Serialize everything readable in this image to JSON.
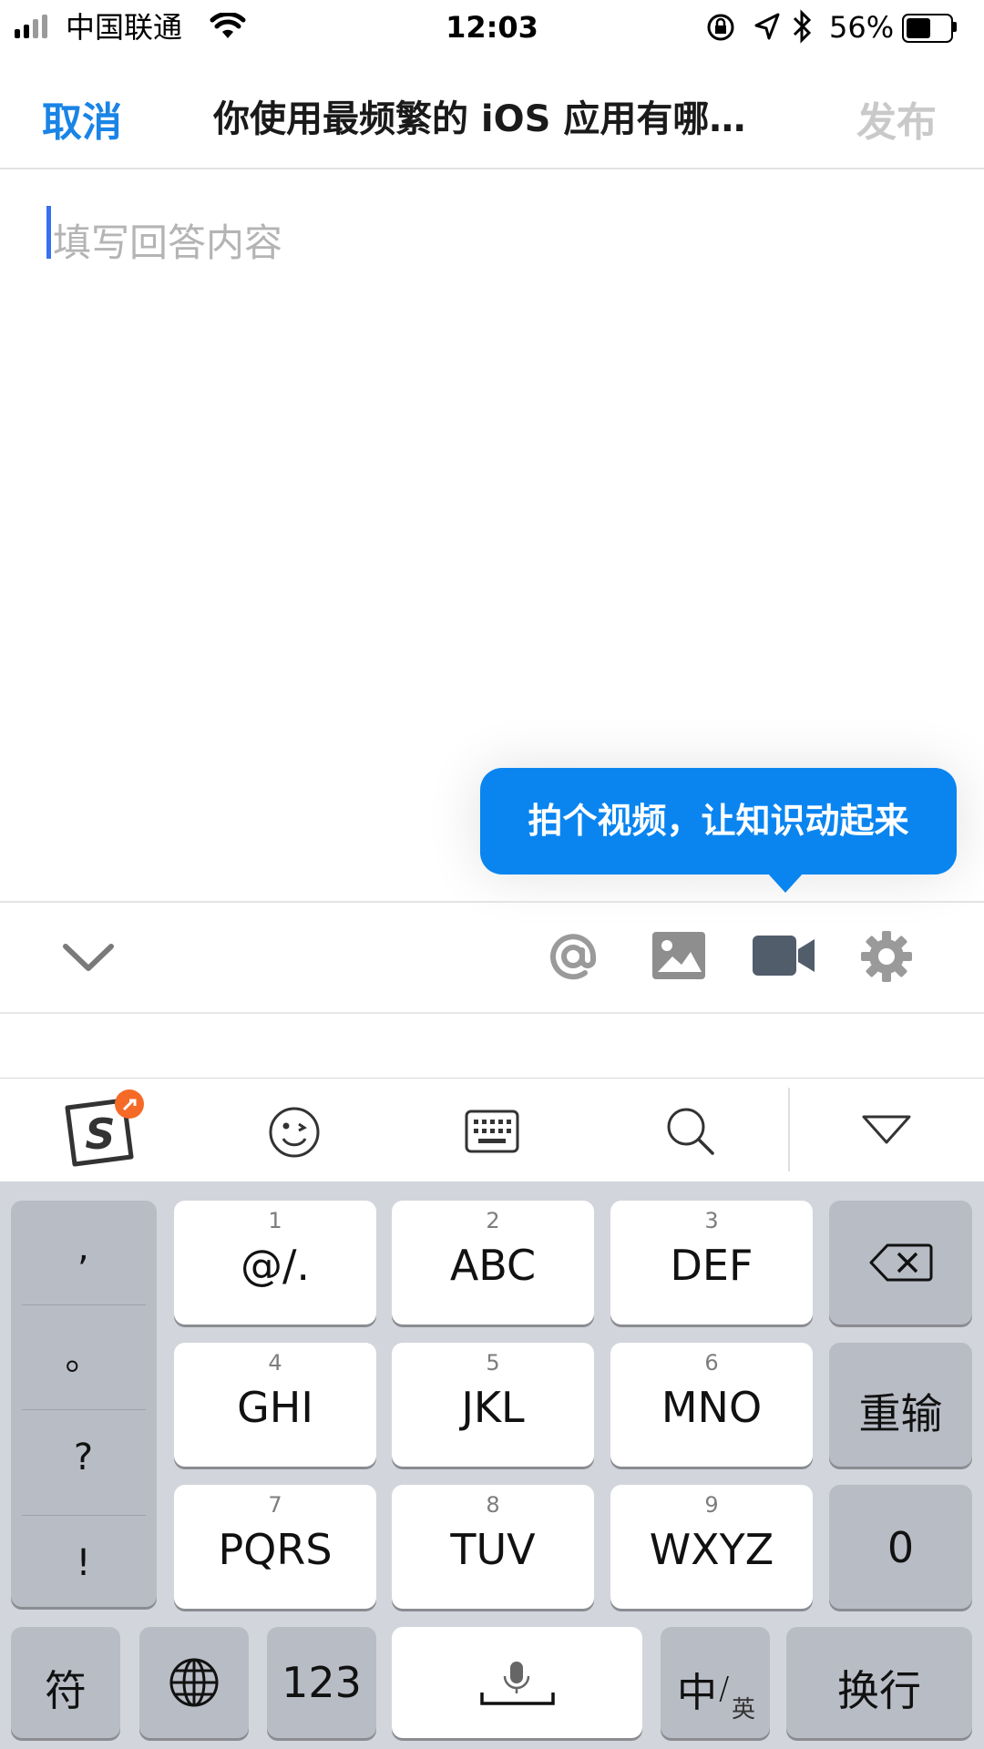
{
  "status_bar": {
    "carrier": "中国联通",
    "time": "12:03",
    "battery_percent": "56%",
    "battery_level": 0.56
  },
  "nav": {
    "cancel_label": "取消",
    "title": "你使用最频繁的 iOS 应用有哪…",
    "publish_label": "发布"
  },
  "editor": {
    "placeholder": "填写回答内容"
  },
  "tooltip": {
    "text": "拍个视频，让知识动起来"
  },
  "toolbar": {
    "icons": [
      "chevron-down-icon",
      "at-icon",
      "image-icon",
      "video-camera-icon",
      "gear-icon"
    ]
  },
  "keyboard": {
    "top_bar_icons": [
      "sogou-logo-icon",
      "emoji-icon",
      "keyboard-icon",
      "search-icon",
      "collapse-triangle-icon"
    ],
    "punctuation": [
      ",",
      "。",
      "?",
      "!"
    ],
    "keys": [
      {
        "num": "1",
        "label": "@/."
      },
      {
        "num": "2",
        "label": "ABC"
      },
      {
        "num": "3",
        "label": "DEF"
      },
      {
        "num": "4",
        "label": "GHI"
      },
      {
        "num": "5",
        "label": "JKL"
      },
      {
        "num": "6",
        "label": "MNO"
      },
      {
        "num": "7",
        "label": "PQRS"
      },
      {
        "num": "8",
        "label": "TUV"
      },
      {
        "num": "9",
        "label": "WXYZ"
      }
    ],
    "reinput_label": "重输",
    "zero_label": "0",
    "symbol_label": "符",
    "numbers_label": "123",
    "cn_label": "中",
    "en_label": "英",
    "return_label": "换行"
  },
  "colors": {
    "accent": "#1a84e6",
    "tooltip": "#0a85f0",
    "disabled": "#c9c9c9"
  }
}
